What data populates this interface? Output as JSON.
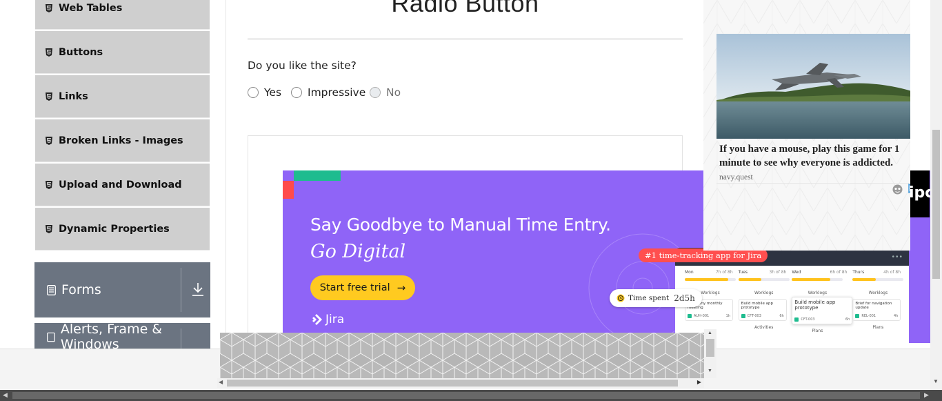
{
  "sidebar": {
    "items": [
      {
        "label": "Web Tables"
      },
      {
        "label": "Buttons"
      },
      {
        "label": "Links"
      },
      {
        "label": "Broken Links - Images"
      },
      {
        "label": "Upload and Download"
      },
      {
        "label": "Dynamic Properties"
      }
    ],
    "groups": [
      {
        "label": "Forms"
      },
      {
        "label": "Alerts, Frame & Windows"
      }
    ]
  },
  "main": {
    "title": "Radio Button",
    "question": "Do you like the site?",
    "options": [
      {
        "label": "Yes",
        "disabled": false
      },
      {
        "label": "Impressive",
        "disabled": false
      },
      {
        "label": "No",
        "disabled": true
      }
    ]
  },
  "jira_ad": {
    "headline": "Say Goodbye to Manual Time Entry.",
    "subhead": "Go Digital",
    "cta": "Start free trial",
    "brand": "Jira",
    "badge": "#1 time-tracking app for Jira",
    "time_spent_label": "Time spent",
    "time_spent_value": "2d5h",
    "days": [
      {
        "day": "Mon",
        "hours": "7h of 8h",
        "fill": 0.85
      },
      {
        "day": "Tues",
        "hours": "3h of 8h",
        "fill": 0.45
      },
      {
        "day": "Wed",
        "hours": "6h of 8h",
        "fill": 0.75
      },
      {
        "day": "Thurs",
        "hours": "4h of 8h",
        "fill": 0.45
      }
    ],
    "worklogs_label": "Worklogs",
    "cards": [
      {
        "title": "Company monthly meeting",
        "code": "AUH-001",
        "h": "1h"
      },
      {
        "title": "Build mobile app prototype",
        "code": "CFT-003",
        "h": "6h"
      },
      {
        "title": "Build mobile app prototype",
        "code": "CFT-003",
        "h": "6h"
      },
      {
        "title": "Brief for navigation update",
        "code": "REL-001",
        "h": "4h"
      }
    ],
    "footer": [
      "",
      "Activities",
      "Plans",
      "Plans"
    ]
  },
  "right_ad": {
    "headline": "If you have a mouse, play this game for 1 minute to see why everyone is addicted.",
    "source": "navy.quest",
    "partial_text": "ipc"
  },
  "colors": {
    "sidebar_item": "#cfcfcf",
    "group_header": "#6b7481",
    "jira_purple": "#8f64f7",
    "cta_yellow": "#ffca20",
    "badge_red": "#ff4f4f"
  }
}
